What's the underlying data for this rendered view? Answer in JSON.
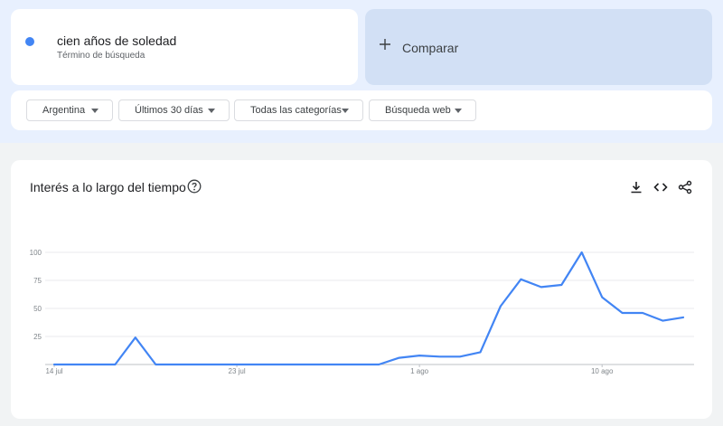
{
  "search_term": {
    "name": "cien años de soledad",
    "subtitle": "Término de búsqueda",
    "color": "#4285f4"
  },
  "compare": {
    "label": "Comparar"
  },
  "filters": {
    "region": "Argentina",
    "time": "Últimos 30 días",
    "category": "Todas las categorías",
    "search_type": "Búsqueda web"
  },
  "chart_panel": {
    "title": "Interés a lo largo del tiempo",
    "icons": [
      "help-icon",
      "download-icon",
      "embed-icon",
      "share-icon"
    ]
  },
  "chart_data": {
    "type": "line",
    "yticks": [
      25,
      50,
      75,
      100
    ],
    "ylim": [
      0,
      100
    ],
    "xtick_labels": [
      {
        "label": "14 jul",
        "index": 0
      },
      {
        "label": "23 jul",
        "index": 9
      },
      {
        "label": "1 ago",
        "index": 18
      },
      {
        "label": "10 ago",
        "index": 27
      }
    ],
    "grid": true,
    "series": [
      {
        "name": "cien años de soledad",
        "color": "#4285f4",
        "values": [
          0,
          0,
          0,
          0,
          24,
          0,
          0,
          0,
          0,
          0,
          0,
          0,
          0,
          0,
          0,
          0,
          0,
          6,
          8,
          7,
          7,
          11,
          52,
          76,
          69,
          71,
          100,
          60,
          46,
          46,
          39,
          42
        ]
      }
    ]
  }
}
